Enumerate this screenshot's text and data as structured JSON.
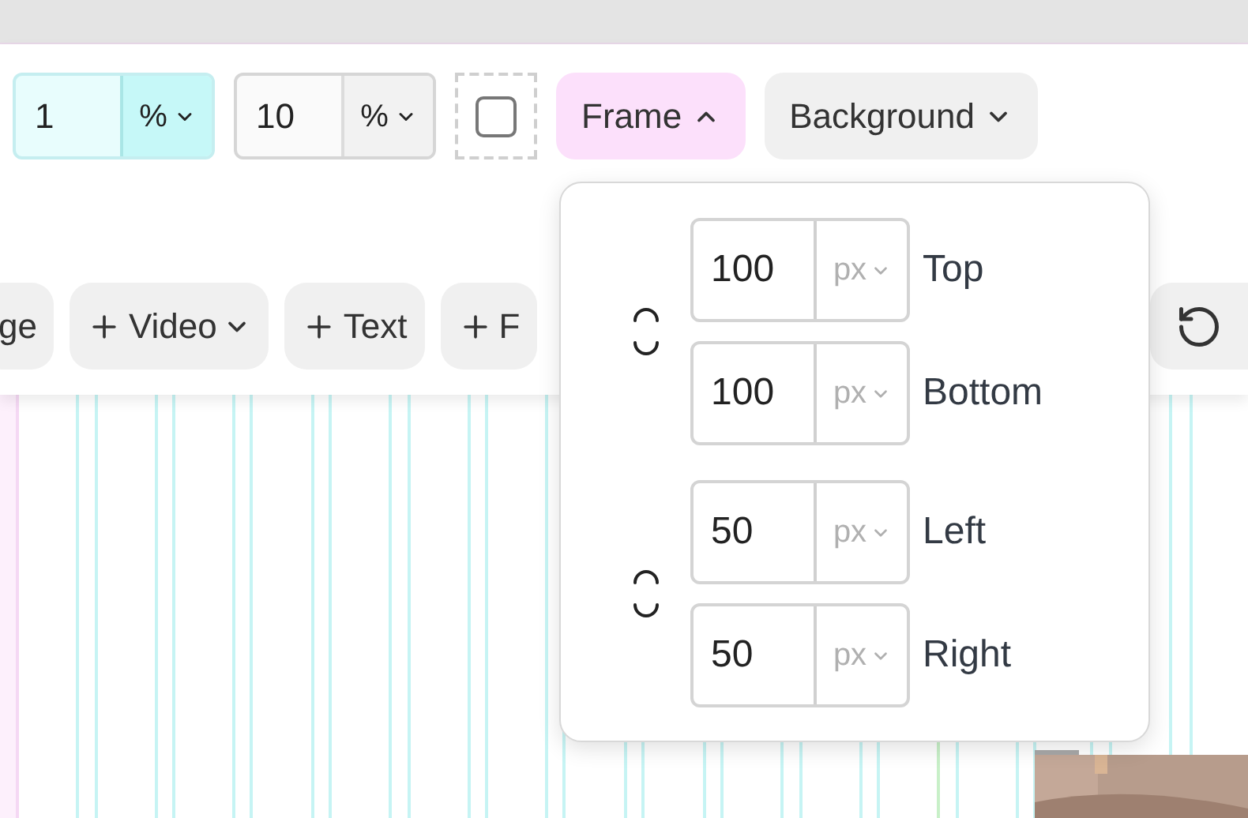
{
  "toolbar": {
    "size_fields": [
      {
        "value": "1",
        "unit": "%",
        "selected": true
      },
      {
        "value": "10",
        "unit": "%",
        "selected": false
      }
    ],
    "checkbox": {
      "checked": false
    },
    "menus": [
      {
        "label": "Frame",
        "expanded": true
      },
      {
        "label": "Background",
        "expanded": false
      }
    ],
    "add_buttons": [
      {
        "label": "ge",
        "dropdown": false
      },
      {
        "label": "Video",
        "dropdown": true
      },
      {
        "label": "Text",
        "dropdown": false
      },
      {
        "label": "F",
        "dropdown": false
      }
    ]
  },
  "frame_popover": {
    "groups": [
      {
        "linked": false,
        "fields": [
          {
            "value": "100",
            "unit": "px",
            "label": "Top"
          },
          {
            "value": "100",
            "unit": "px",
            "label": "Bottom"
          }
        ]
      },
      {
        "linked": false,
        "fields": [
          {
            "value": "50",
            "unit": "px",
            "label": "Left"
          },
          {
            "value": "50",
            "unit": "px",
            "label": "Right"
          }
        ]
      }
    ]
  }
}
